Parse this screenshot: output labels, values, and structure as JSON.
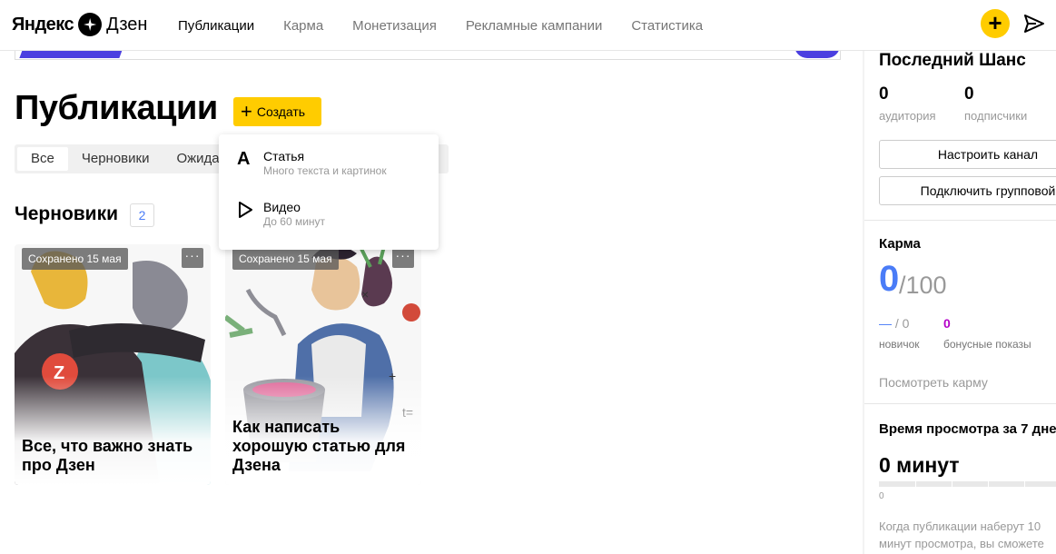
{
  "header": {
    "logo_brand": "Яндекс",
    "logo_product": "Дзен",
    "nav": [
      {
        "label": "Публикации",
        "active": true
      },
      {
        "label": "Карма",
        "active": false
      },
      {
        "label": "Монетизация",
        "active": false
      },
      {
        "label": "Рекламные кампании",
        "active": false
      },
      {
        "label": "Статистика",
        "active": false
      }
    ],
    "plus_icon": "+",
    "accent": "#ffcc00"
  },
  "main": {
    "title": "Публикации",
    "create_label": "Создать",
    "tabs": [
      "Все",
      "Черновики",
      "Ожидаю"
    ],
    "drafts_title": "Черновики",
    "drafts_count": "2",
    "cards": [
      {
        "saved": "Сохранено 15 мая",
        "more": "···",
        "title": "Все, что важно знать про Дзен"
      },
      {
        "saved": "Сохранено 15 мая",
        "more": "···",
        "title": "Как написать хорошую статью для Дзена"
      }
    ]
  },
  "dropdown": {
    "items": [
      {
        "icon": "A",
        "label": "Статья",
        "sub": "Много текста и картинок"
      },
      {
        "icon": "play-icon",
        "label": "Видео",
        "sub": "До 60 минут"
      }
    ]
  },
  "sidebar": {
    "channel_name": "Последний Шанс",
    "audience_value": "0",
    "audience_label": "аудитория",
    "subscribers_value": "0",
    "subscribers_label": "подписчики",
    "configure_button": "Настроить канал",
    "group_button": "Подключить групповой",
    "karma_title": "Карма",
    "karma_value": "0",
    "karma_of": "/100",
    "newbie_value_dash": "—",
    "newbie_value_rest": " / 0",
    "newbie_label": "новичок",
    "bonus_value": "0",
    "bonus_label": "бонусные показы",
    "karma_link": "Посмотреть карму",
    "views_title": "Время просмотра за 7 дне",
    "views_value": "0 минут",
    "progress_zero": "0",
    "views_note_1": "Когда публикации наберут 10",
    "views_note_2": "минут просмотра, вы сможете",
    "karma_color": "#4a7cf7",
    "bonus_color": "#b400c8"
  }
}
